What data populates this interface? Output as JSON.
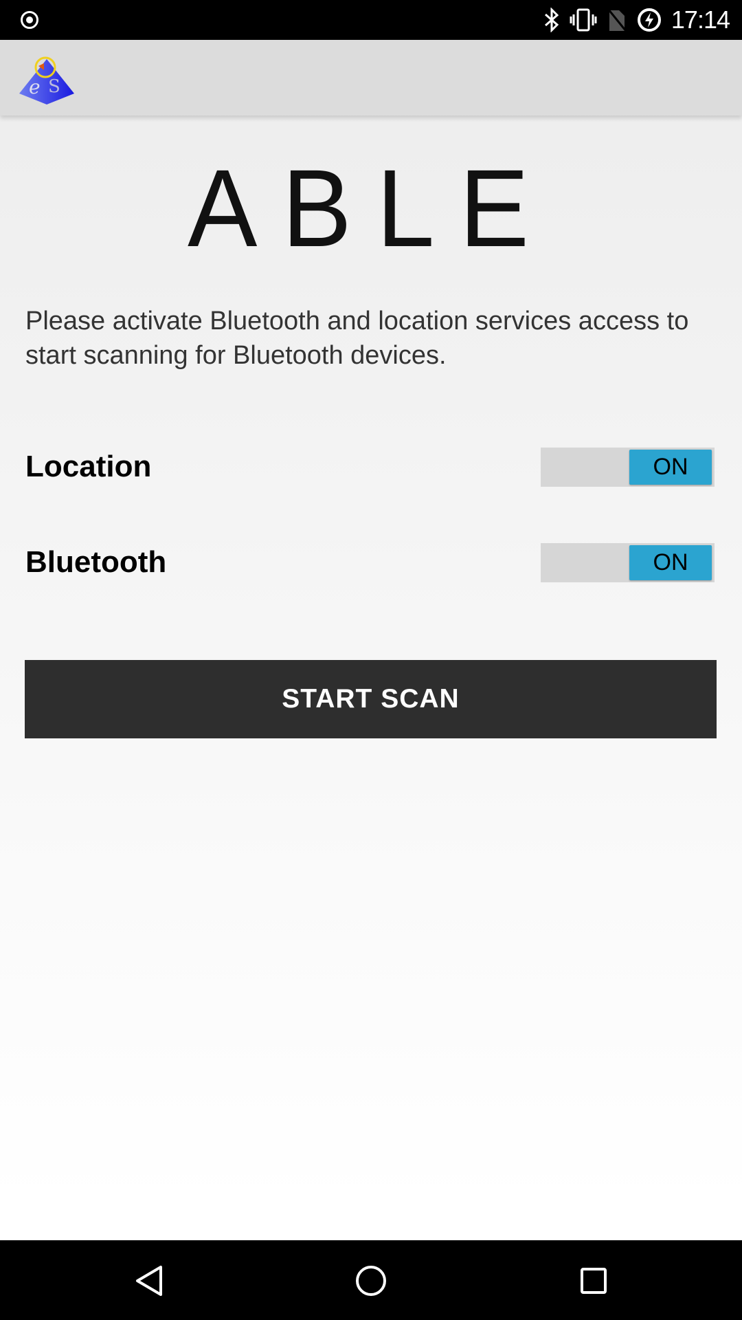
{
  "status_bar": {
    "time": "17:14",
    "icons": [
      "record-icon",
      "bluetooth-icon",
      "vibrate-icon",
      "no-sim-icon",
      "battery-charging-icon"
    ]
  },
  "app": {
    "title": "ABLE",
    "description": "Please activate Bluetooth and location services access to start scanning for Bluetooth devices."
  },
  "settings": [
    {
      "label": "Location",
      "state": "ON"
    },
    {
      "label": "Bluetooth",
      "state": "ON"
    }
  ],
  "actions": {
    "start_scan": "START SCAN"
  },
  "colors": {
    "accent": "#2ba4d0",
    "button": "#2e2e2e"
  }
}
